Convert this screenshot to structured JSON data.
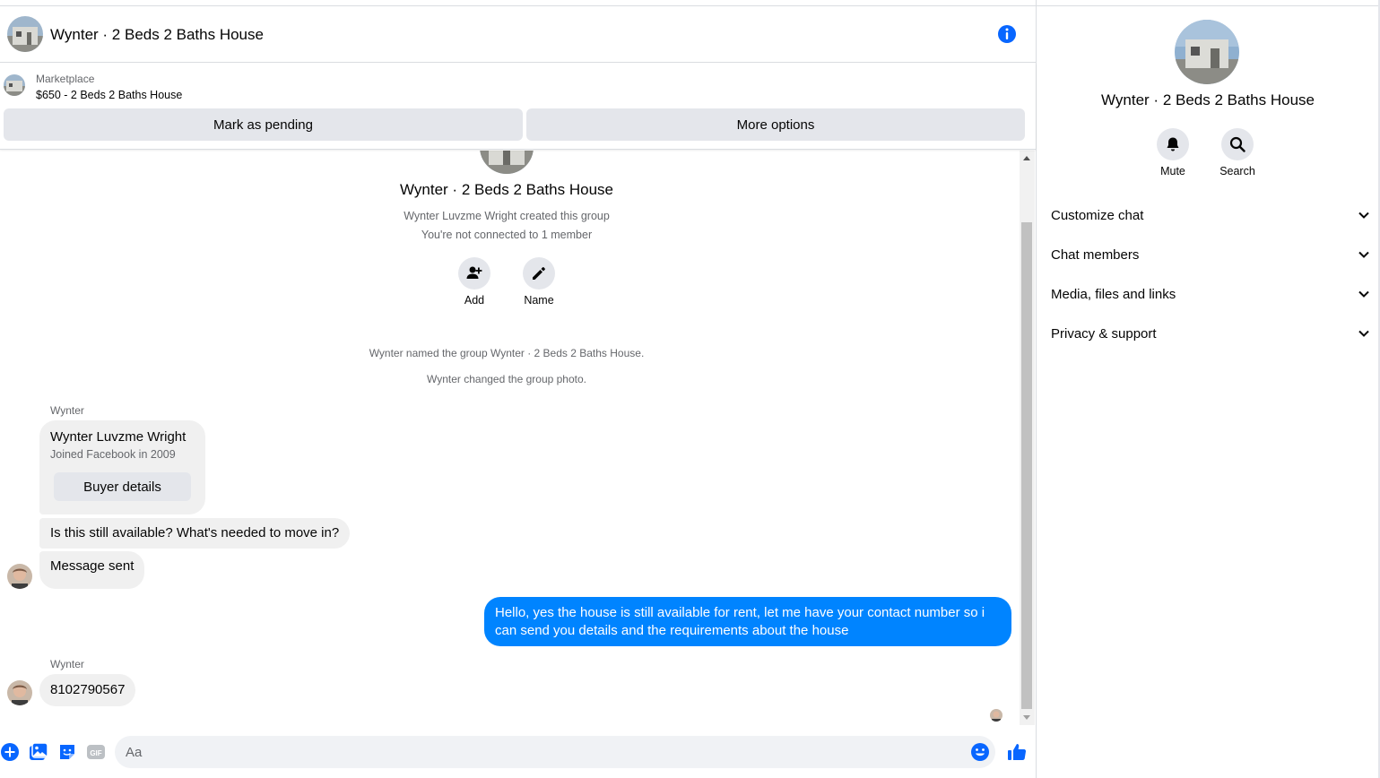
{
  "header": {
    "title": "Wynter · 2 Beds 2 Baths House"
  },
  "listing": {
    "source": "Marketplace",
    "price_title": "$650 - 2 Beds 2 Baths House",
    "mark_pending_label": "Mark as pending",
    "more_options_label": "More options"
  },
  "thread": {
    "group_title": "Wynter · 2 Beds 2 Baths House",
    "created_text": "Wynter Luvzme Wright created this group",
    "connection_text": "You're not connected to 1 member",
    "add_label": "Add",
    "name_label": "Name",
    "system_messages": [
      "Wynter named the group Wynter · 2 Beds 2 Baths House.",
      "Wynter changed the group photo."
    ],
    "sender_1": "Wynter",
    "buyer_card": {
      "name": "Wynter Luvzme Wright",
      "joined": "Joined Facebook in 2009",
      "button": "Buyer details"
    },
    "msg_question": "Is this still available? What's needed to move in?",
    "msg_sent": "Message sent",
    "msg_reply": "Hello, yes the house is still available for rent, let me have your contact number so i can send you details and the requirements about the house",
    "sender_2": "Wynter",
    "msg_number": "8102790567"
  },
  "composer": {
    "placeholder": "Aa"
  },
  "sidebar": {
    "name": "Wynter · 2 Beds 2 Baths House",
    "mute_label": "Mute",
    "search_label": "Search",
    "sections": [
      {
        "label": "Customize chat"
      },
      {
        "label": "Chat members"
      },
      {
        "label": "Media, files and links"
      },
      {
        "label": "Privacy & support"
      }
    ]
  },
  "colors": {
    "accent": "#0084ff",
    "icon_blue": "#0866ff",
    "bubble_gray": "#f0f0f0",
    "button_gray": "#e4e6eb"
  }
}
